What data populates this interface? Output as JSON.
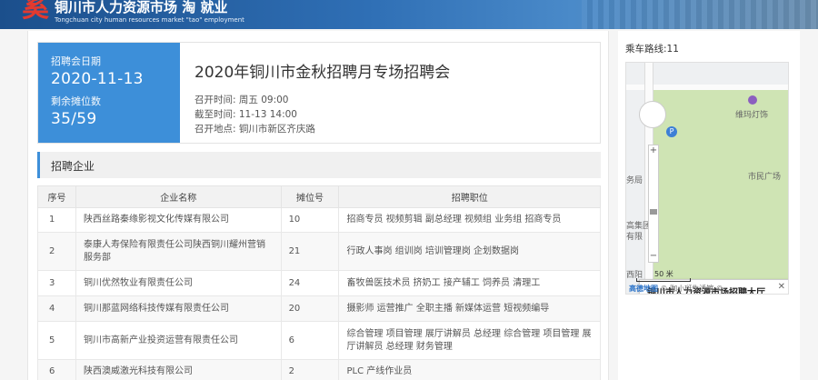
{
  "header": {
    "title": "铜川市人力资源市场  淘   就业",
    "subtitle": "Tongchuan city human resources market \"tao\" employment"
  },
  "fair": {
    "date_label": "招聘会日期",
    "date": "2020-11-13",
    "booths_label": "剩余摊位数",
    "booths": "35/59",
    "name": "2020年铜川市金秋招聘月专场招聘会",
    "open_time": "召开时间: 周五 09:00",
    "deadline": "截至时间: 11-13 14:00",
    "location": "召开地点: 铜川市新区齐庆路"
  },
  "section": {
    "title": "招聘企业"
  },
  "table": {
    "headers": [
      "序号",
      "企业名称",
      "摊位号",
      "招聘职位"
    ],
    "rows": [
      {
        "no": "1",
        "name": "陕西丝路秦缘影视文化传媒有限公司",
        "booth": "10",
        "positions": "招商专员 视频剪辑 副总经理 视频组 业务组 招商专员"
      },
      {
        "no": "2",
        "name": "泰康人寿保险有限责任公司陕西铜川耀州营销服务部",
        "booth": "21",
        "positions": "行政人事岗 组训岗 培训管理岗 企划数据岗"
      },
      {
        "no": "3",
        "name": "铜川优然牧业有限责任公司",
        "booth": "24",
        "positions": "畜牧兽医技术员 挤奶工 接产辅工 饲养员 清理工"
      },
      {
        "no": "4",
        "name": "铜川那蓝网络科技传媒有限责任公司",
        "booth": "20",
        "positions": "摄影师 运营推广 全职主播 新媒体运营 短视频编导"
      },
      {
        "no": "5",
        "name": "铜川市高新产业投资运营有限责任公司",
        "booth": "6",
        "positions": "综合管理 项目管理 展厅讲解员 总经理 综合管理 项目管理 展厅讲解员 总经理 财务管理"
      },
      {
        "no": "6",
        "name": "陕西澳威激光科技有限公司",
        "booth": "2",
        "positions": "PLC 产线作业员"
      }
    ]
  },
  "sidebar": {
    "route": "乘车路线:11",
    "map": {
      "poi_1": "维玛灯饰",
      "poi_2": "市民广场",
      "poi_3": "务局",
      "poi_4": "高集团",
      "poi_5": "有限",
      "poi_6": "西阳",
      "popup": "铜川市人力资源市场招聘大厅",
      "scale": "50 米",
      "attribution_brand": "高德地图",
      "attribution_rest": "© 咖小斑生活馆 ©"
    }
  }
}
